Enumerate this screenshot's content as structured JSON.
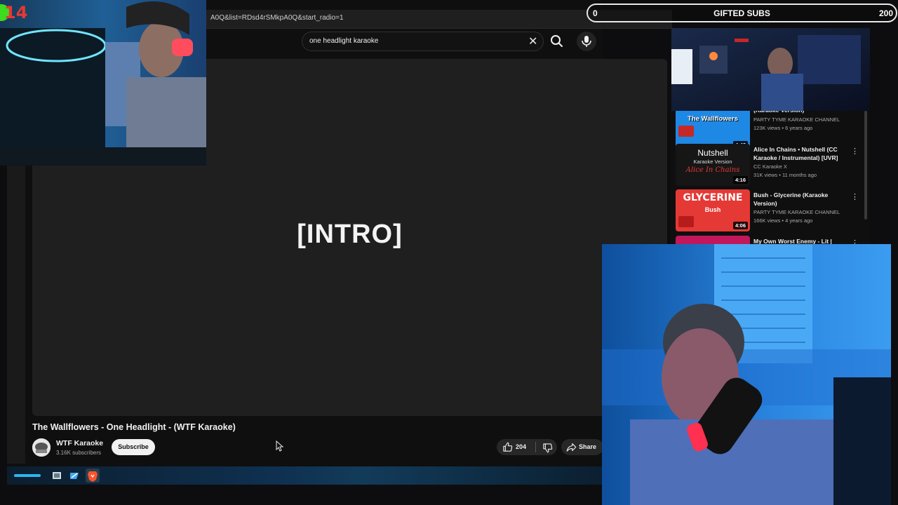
{
  "browser": {
    "url": "A0Q&list=RDsd4rSMkpA0Q&start_radio=1"
  },
  "search": {
    "query": "one headlight karaoke",
    "clear_icon": "close-icon",
    "search_icon": "search-icon",
    "mic_icon": "microphone-icon"
  },
  "player": {
    "caption": "[INTRO]"
  },
  "video": {
    "title": "The Wallflowers - One Headlight - (WTF Karaoke)",
    "channel": "WTF Karaoke",
    "subscribers": "3.16K subscribers",
    "subscribe_label": "Subscribe",
    "likes": "204",
    "share_label": "Share"
  },
  "recommendations": [
    {
      "thumb_text": "The Wallflowers",
      "title": "(Karaoke Version)",
      "channel": "PARTY TYME KARAOKE CHANNEL",
      "meta": "123K views • 6 years ago",
      "duration": "4:42",
      "accent": "#1e88e5"
    },
    {
      "thumb_text": "Nutshell",
      "thumb_sub": "Karaoke Version",
      "thumb_sub2": "Alice In Chains",
      "title": "Alice In Chains • Nutshell (CC Karaoke / Instrumental) [UVR]",
      "channel": "CC Karaoke X",
      "meta": "31K views • 11 months ago",
      "duration": "4:16",
      "accent": "#1a1a1a"
    },
    {
      "thumb_text": "GLYCERINE",
      "thumb_sub": "Bush",
      "title": "Bush - Glycerine (Karaoke Version)",
      "channel": "PARTY TYME KARAOKE CHANNEL",
      "meta": "166K views • 4 years ago",
      "duration": "4:06",
      "accent": "#e53935"
    },
    {
      "title": "My Own Worst Enemy - Lit |",
      "accent": "#c2185b"
    }
  ],
  "overlay": {
    "goal_min": "0",
    "goal_label": "GIFTED SUBS",
    "goal_max": "200",
    "counter": "14"
  },
  "colors": {
    "background": "#0f0f0f",
    "counter": "#e53935",
    "counter_badge": "#3ddc1e"
  }
}
